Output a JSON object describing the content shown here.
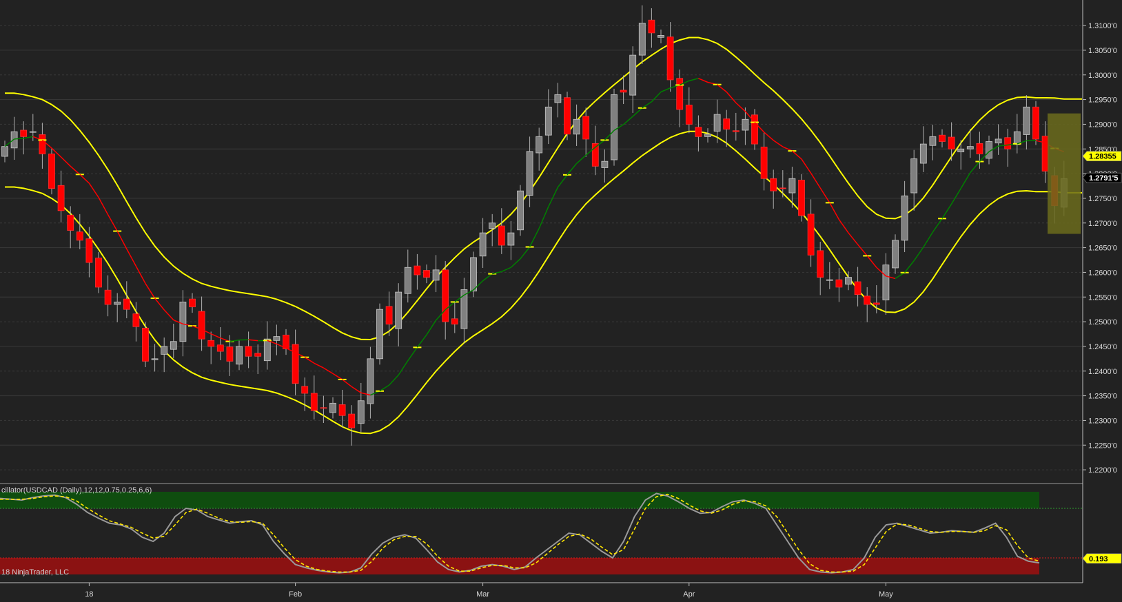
{
  "chart_data": {
    "type": "candlestick",
    "symbol_label": "cillator(USDCAD (Daily),12,12,0.75,0.25,6,6)",
    "copyright": "18 NinjaTrader, LLC",
    "price_axis": {
      "ylim": [
        1.2175,
        1.3135
      ],
      "ticks": [
        "1.3100'0",
        "1.3050'0",
        "1.3000'0",
        "1.2950'0",
        "1.2900'0",
        "1.2850'0",
        "1.2800'0",
        "1.2750'0",
        "1.2700'0",
        "1.2650'0",
        "1.2600'0",
        "1.2550'0",
        "1.2500'0",
        "1.2450'0",
        "1.2400'0",
        "1.2350'0",
        "1.2300'0",
        "1.2250'0",
        "1.2200'0"
      ],
      "tick_values": [
        1.31,
        1.305,
        1.3,
        1.295,
        1.29,
        1.285,
        1.28,
        1.275,
        1.27,
        1.265,
        1.26,
        1.255,
        1.25,
        1.245,
        1.24,
        1.235,
        1.23,
        1.225,
        1.22
      ]
    },
    "x_axis": {
      "bar_count": 100,
      "labels": [
        {
          "text": "18",
          "bar": 9
        },
        {
          "text": "Feb",
          "bar": 31
        },
        {
          "text": "Mar",
          "bar": 51
        },
        {
          "text": "Apr",
          "bar": 73
        },
        {
          "text": "May",
          "bar": 94
        }
      ]
    },
    "price_badges": [
      {
        "text": "1.28355",
        "value": 1.28355,
        "bg": "#ffff00",
        "fg": "#000000"
      },
      {
        "text": "1.2791'5",
        "value": 1.27915,
        "bg": "#000000",
        "fg": "#ffffff"
      }
    ],
    "oscillator_badges": [
      {
        "text": "0.193",
        "value": 0.193,
        "bg": "#ffff00",
        "fg": "#000000"
      }
    ],
    "closes": [
      1.2855,
      1.2885,
      1.2875,
      1.2885,
      1.284,
      1.277,
      1.2725,
      1.2685,
      1.2665,
      1.262,
      1.257,
      1.2535,
      1.254,
      1.2525,
      1.249,
      1.242,
      1.2425,
      1.245,
      1.246,
      1.254,
      1.253,
      1.2465,
      1.245,
      1.244,
      1.242,
      1.245,
      1.243,
      1.243,
      1.2465,
      1.247,
      1.2445,
      1.2375,
      1.2355,
      1.232,
      1.2325,
      1.2335,
      1.231,
      1.2285,
      1.234,
      1.2425,
      1.2525,
      1.2495,
      1.256,
      1.261,
      1.2595,
      1.259,
      1.2605,
      1.25,
      1.2495,
      1.2565,
      1.263,
      1.268,
      1.27,
      1.2655,
      1.268,
      1.2765,
      1.2845,
      1.2875,
      1.2935,
      1.296,
      1.288,
      1.291,
      1.287,
      1.2815,
      1.2825,
      1.296,
      1.2965,
      1.304,
      1.3105,
      1.3085,
      1.308,
      1.299,
      1.293,
      1.29,
      1.2875,
      1.288,
      1.292,
      1.289,
      1.2885,
      1.291,
      1.286,
      1.279,
      1.2765,
      1.277,
      1.279,
      1.2715,
      1.2635,
      1.259,
      1.2585,
      1.257,
      1.259,
      1.2555,
      1.2535,
      1.2535,
      1.2615,
      1.2665,
      1.2755,
      1.283,
      1.286,
      1.2875,
      1.2865,
      1.285,
      1.285,
      1.2855,
      1.284,
      1.2865,
      1.287,
      1.285,
      1.2885,
      1.2935,
      1.287,
      1.2805,
      1.2735,
      1.279
    ],
    "oscillator": {
      "ylim": [
        -0.1,
        1.1
      ],
      "upper_level": 0.8,
      "lower_level": 0.2,
      "fast": [
        0.92,
        0.91,
        0.9,
        0.93,
        0.95,
        0.96,
        0.93,
        0.85,
        0.75,
        0.68,
        0.62,
        0.6,
        0.55,
        0.45,
        0.4,
        0.5,
        0.7,
        0.8,
        0.78,
        0.7,
        0.66,
        0.62,
        0.64,
        0.65,
        0.6,
        0.4,
        0.25,
        0.12,
        0.08,
        0.05,
        0.03,
        0.02,
        0.03,
        0.08,
        0.25,
        0.38,
        0.45,
        0.48,
        0.44,
        0.3,
        0.15,
        0.06,
        0.03,
        0.05,
        0.1,
        0.12,
        0.1,
        0.06,
        0.09,
        0.2,
        0.3,
        0.4,
        0.5,
        0.48,
        0.38,
        0.28,
        0.2,
        0.4,
        0.7,
        0.9,
        0.98,
        0.95,
        0.88,
        0.8,
        0.74,
        0.75,
        0.82,
        0.88,
        0.9,
        0.86,
        0.8,
        0.6,
        0.4,
        0.2,
        0.06,
        0.03,
        0.02,
        0.03,
        0.06,
        0.2,
        0.45,
        0.6,
        0.62,
        0.58,
        0.54,
        0.5,
        0.51,
        0.53,
        0.52,
        0.51,
        0.56,
        0.62,
        0.45,
        0.22,
        0.16,
        0.14
      ],
      "slow": [
        0.91,
        0.91,
        0.91,
        0.92,
        0.94,
        0.95,
        0.94,
        0.89,
        0.8,
        0.72,
        0.65,
        0.61,
        0.57,
        0.5,
        0.44,
        0.46,
        0.6,
        0.75,
        0.79,
        0.74,
        0.68,
        0.64,
        0.63,
        0.64,
        0.62,
        0.48,
        0.32,
        0.18,
        0.1,
        0.06,
        0.04,
        0.03,
        0.03,
        0.05,
        0.16,
        0.32,
        0.42,
        0.46,
        0.46,
        0.37,
        0.22,
        0.1,
        0.04,
        0.04,
        0.08,
        0.11,
        0.11,
        0.08,
        0.08,
        0.14,
        0.25,
        0.36,
        0.46,
        0.49,
        0.43,
        0.33,
        0.24,
        0.3,
        0.55,
        0.8,
        0.94,
        0.97,
        0.92,
        0.84,
        0.77,
        0.74,
        0.78,
        0.85,
        0.89,
        0.88,
        0.83,
        0.7,
        0.5,
        0.3,
        0.13,
        0.05,
        0.03,
        0.03,
        0.04,
        0.12,
        0.32,
        0.52,
        0.61,
        0.6,
        0.56,
        0.52,
        0.51,
        0.52,
        0.52,
        0.51,
        0.53,
        0.59,
        0.54,
        0.35,
        0.2,
        0.16
      ]
    },
    "colors": {
      "background": "#222222",
      "up_candle": "#808080",
      "down_candle": "#ff0000",
      "band": "#ffff00",
      "trail_up": "#008000",
      "trail_down": "#ff0000",
      "upper_zone": "#0f4d0f",
      "lower_zone": "#8b1212"
    }
  }
}
